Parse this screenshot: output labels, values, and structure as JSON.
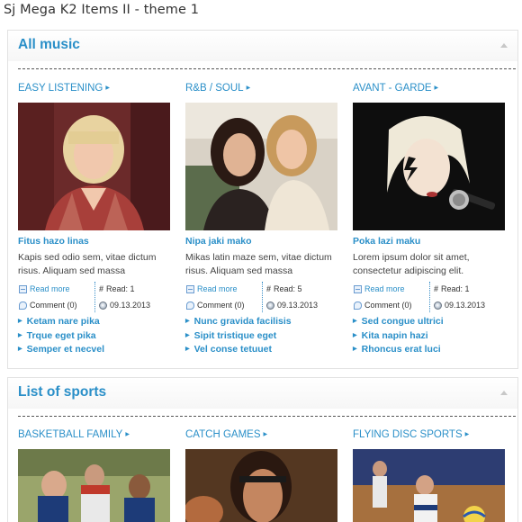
{
  "page": {
    "title": "Sj Mega K2 Items II - theme 1"
  },
  "modules": [
    {
      "title": "All music",
      "columns": [
        {
          "category": "EASY LISTENING",
          "image": "woman with blonde hair in plaid shirt",
          "item_title": "Fitus hazo linas",
          "description": "Kapis sed odio sem, vitae dictum risus. Aliquam sed massa",
          "read_more": "Read more",
          "read": "Read: 1",
          "comment": "Comment (0)",
          "date": "09.13.2013",
          "links": [
            "Ketam nare pika",
            "Trque eget pika",
            "Semper et necvel"
          ]
        },
        {
          "category": "R&B / SOUL",
          "image": "two young women posing",
          "item_title": "Nipa jaki mako",
          "description": "Mikas latin maze sem, vitae dictum risus. Aliquam sed massa",
          "read_more": "Read more",
          "read": "Read: 5",
          "comment": "Comment (0)",
          "date": "09.13.2013",
          "links": [
            "Nunc gravida facilisis",
            "Sipit tristique eget",
            "Vel conse tetuuet"
          ]
        },
        {
          "category": "AVANT - GARDE",
          "image": "blonde singer with lightning face paint and microphone",
          "item_title": "Poka lazi maku",
          "description": "Lorem ipsum dolor sit amet, consectetur adipiscing elit.",
          "read_more": "Read more",
          "read": "Read: 1",
          "comment": "Comment (0)",
          "date": "09.13.2013",
          "links": [
            "Sed congue ultrici",
            "Kita napin hazi",
            "Rhoncus erat luci"
          ]
        }
      ]
    },
    {
      "title": "List of sports",
      "columns": [
        {
          "category": "BASKETBALL FAMILY",
          "image": "women playing field hockey"
        },
        {
          "category": "CATCH GAMES",
          "image": "female athlete portrait"
        },
        {
          "category": "FLYING DISC SPORTS",
          "image": "volleyball players in indoor gym"
        }
      ]
    }
  ],
  "colors": {
    "accent": "#2a8fc8",
    "text": "#444444",
    "border": "#e2e2e2"
  },
  "icons": {
    "read_more": "document-icon",
    "read": "hash-icon",
    "comment": "comment-icon",
    "date": "clock-icon",
    "link_bullet": "triangle-bullet-icon",
    "category_arrow": "triangle-arrow-icon",
    "collapse": "collapse-arrow-icon"
  }
}
